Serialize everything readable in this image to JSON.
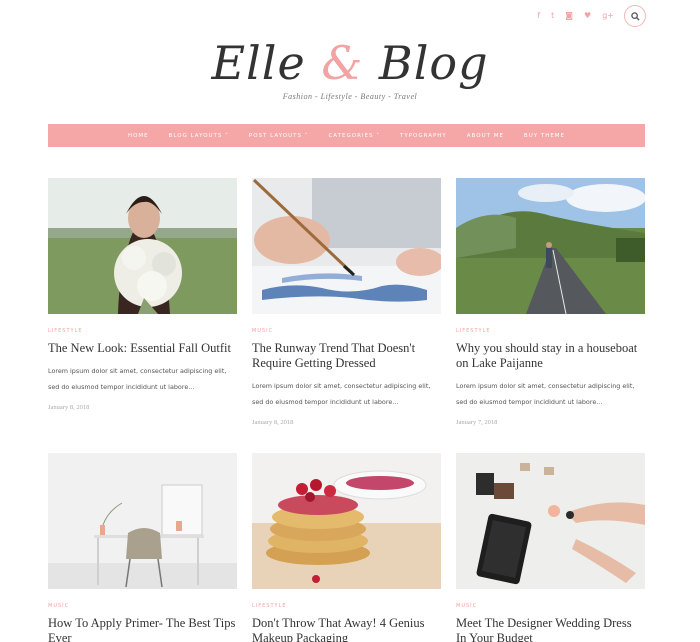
{
  "header": {
    "social_icons": [
      {
        "name": "facebook-icon",
        "glyph": "f"
      },
      {
        "name": "twitter-icon",
        "glyph": "t"
      },
      {
        "name": "instagram-icon",
        "glyph": "◙"
      },
      {
        "name": "heart-icon",
        "glyph": "♥"
      },
      {
        "name": "google-plus-icon",
        "glyph": "g+"
      }
    ],
    "search_icon": "search-icon",
    "logo_part1": "Elle",
    "logo_amp": "&",
    "logo_part2": "Blog",
    "tagline": "Fashion - Lifestyle - Beauty - Travel"
  },
  "nav": {
    "items": [
      "Home",
      "Blog Layouts ˅",
      "Post Layouts ˅",
      "Categories ˅",
      "Typography",
      "About Me",
      "Buy Theme"
    ]
  },
  "colors": {
    "accent": "#f5a6a6",
    "text": "#333333"
  },
  "posts": [
    {
      "category": "Lifestyle",
      "title": "The New Look: Essential Fall Outfit",
      "excerpt": "Lorem ipsum dolor sit amet, consectetur adipiscing elit, sed do eiusmod tempor incididunt ut labore...",
      "date": "January 8, 2018"
    },
    {
      "category": "Music",
      "title": "The Runway Trend That Doesn't Require Getting Dressed",
      "excerpt": "Lorem ipsum dolor sit amet, consectetur adipiscing elit, sed do eiusmod tempor incididunt ut labore...",
      "date": "January 8, 2018"
    },
    {
      "category": "Lifestyle",
      "title": "Why you should stay in a houseboat on Lake Paijanne",
      "excerpt": "Lorem ipsum dolor sit amet, consectetur adipiscing elit, sed do eiusmod tempor incididunt ut labore...",
      "date": "January 7, 2018"
    },
    {
      "category": "Music",
      "title": "How To Apply Primer- The Best Tips Ever",
      "excerpt": "",
      "date": ""
    },
    {
      "category": "Lifestyle",
      "title": "Don't Throw That Away! 4 Genius Makeup Packaging",
      "excerpt": "",
      "date": ""
    },
    {
      "category": "Music",
      "title": "Meet The Designer Wedding Dress In Your Budget",
      "excerpt": "",
      "date": ""
    }
  ]
}
